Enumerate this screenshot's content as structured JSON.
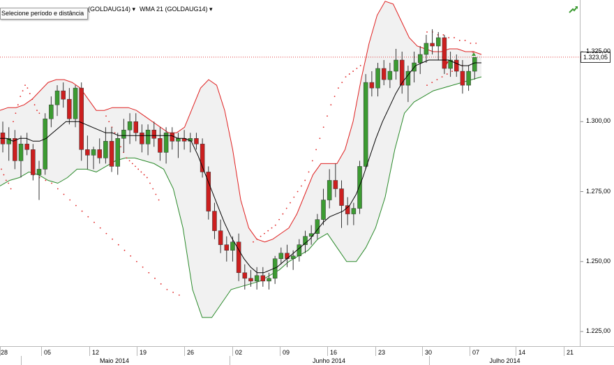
{
  "header": {
    "tooltip": "Selecione período e distância",
    "indicator_1": "(GOLDAUG14)",
    "indicator_2": "WMA 21 (GOLDAUG14)",
    "dropdown_glyph": "▾"
  },
  "price_label": "1.323,05",
  "icons": {
    "trend_icon": "trend-arrow-icon",
    "up_marker": "up-triangle-icon",
    "down_marker": "down-triangle-icon",
    "x_marker": "x-marker-icon"
  },
  "colors": {
    "bull": "#3c9b32",
    "bear": "#cc1f1f",
    "upper_band": "#e02020",
    "lower_band": "#2a8a2a",
    "wma": "#000000",
    "band_fill": "#f1f1f1",
    "sar": "#e02020",
    "price_line": "#e04040"
  },
  "x_axis_dates": [
    "28",
    "05",
    "12",
    "19",
    "26",
    "02",
    "09",
    "16",
    "23",
    "30",
    "07",
    "14",
    "21"
  ],
  "months": [
    "Maio 2014",
    "Junho 2014",
    "Julho 2014"
  ],
  "chart_data": {
    "type": "candlestick",
    "instrument": "GOLDAUG14",
    "y_ticks": [
      "1.225,00",
      "1.250,00",
      "1.275,00",
      "1.300,00",
      "1.325,00"
    ],
    "ylim": [
      1220,
      1345
    ],
    "last_price": 1323.05,
    "x_ticks": [
      "28",
      "05",
      "12",
      "19",
      "26",
      "02",
      "09",
      "16",
      "23",
      "30",
      "07",
      "14",
      "21"
    ],
    "months": [
      "Maio 2014",
      "Junho 2014",
      "Julho 2014"
    ],
    "candles_ohlc": [
      [
        1296,
        1300,
        1289,
        1292
      ],
      [
        1292,
        1298,
        1286,
        1294
      ],
      [
        1294,
        1297,
        1283,
        1286
      ],
      [
        1286,
        1295,
        1280,
        1292
      ],
      [
        1292,
        1296,
        1288,
        1290
      ],
      [
        1290,
        1292,
        1279,
        1281
      ],
      [
        1281,
        1286,
        1272,
        1283
      ],
      [
        1283,
        1303,
        1281,
        1301
      ],
      [
        1301,
        1309,
        1298,
        1306
      ],
      [
        1306,
        1313,
        1302,
        1311
      ],
      [
        1311,
        1314,
        1305,
        1308
      ],
      [
        1308,
        1312,
        1299,
        1301
      ],
      [
        1301,
        1313,
        1298,
        1312
      ],
      [
        1312,
        1314,
        1286,
        1290
      ],
      [
        1290,
        1295,
        1283,
        1288
      ],
      [
        1288,
        1291,
        1283,
        1290
      ],
      [
        1290,
        1294,
        1285,
        1287
      ],
      [
        1287,
        1298,
        1285,
        1293
      ],
      [
        1293,
        1298,
        1282,
        1284
      ],
      [
        1284,
        1296,
        1281,
        1294
      ],
      [
        1294,
        1301,
        1289,
        1297
      ],
      [
        1297,
        1303,
        1292,
        1300
      ],
      [
        1300,
        1303,
        1293,
        1296
      ],
      [
        1296,
        1299,
        1289,
        1292
      ],
      [
        1292,
        1299,
        1288,
        1297
      ],
      [
        1297,
        1300,
        1291,
        1294
      ],
      [
        1294,
        1298,
        1286,
        1289
      ],
      [
        1289,
        1298,
        1285,
        1296
      ],
      [
        1296,
        1298,
        1290,
        1293
      ],
      [
        1293,
        1296,
        1287,
        1294
      ],
      [
        1294,
        1297,
        1290,
        1293
      ],
      [
        1293,
        1296,
        1289,
        1294
      ],
      [
        1294,
        1296,
        1290,
        1292
      ],
      [
        1292,
        1294,
        1280,
        1282
      ],
      [
        1282,
        1284,
        1265,
        1268
      ],
      [
        1268,
        1271,
        1258,
        1261
      ],
      [
        1261,
        1265,
        1253,
        1256
      ],
      [
        1256,
        1259,
        1250,
        1254
      ],
      [
        1254,
        1259,
        1250,
        1257
      ],
      [
        1257,
        1260,
        1243,
        1246
      ],
      [
        1246,
        1249,
        1240,
        1244
      ],
      [
        1244,
        1247,
        1241,
        1243
      ],
      [
        1243,
        1248,
        1240,
        1245
      ],
      [
        1245,
        1248,
        1241,
        1243
      ],
      [
        1243,
        1246,
        1240,
        1244
      ],
      [
        1244,
        1252,
        1242,
        1251
      ],
      [
        1251,
        1255,
        1249,
        1253
      ],
      [
        1253,
        1256,
        1248,
        1251
      ],
      [
        1251,
        1254,
        1247,
        1252
      ],
      [
        1252,
        1258,
        1250,
        1256
      ],
      [
        1256,
        1261,
        1253,
        1259
      ],
      [
        1259,
        1263,
        1256,
        1260
      ],
      [
        1260,
        1267,
        1258,
        1265
      ],
      [
        1265,
        1276,
        1263,
        1272
      ],
      [
        1272,
        1283,
        1269,
        1279
      ],
      [
        1279,
        1285,
        1273,
        1276
      ],
      [
        1276,
        1279,
        1262,
        1270
      ],
      [
        1270,
        1273,
        1263,
        1267
      ],
      [
        1267,
        1271,
        1263,
        1269
      ],
      [
        1269,
        1286,
        1267,
        1284
      ],
      [
        1284,
        1317,
        1283,
        1314
      ],
      [
        1314,
        1318,
        1309,
        1312
      ],
      [
        1312,
        1321,
        1309,
        1319
      ],
      [
        1319,
        1322,
        1313,
        1315
      ],
      [
        1315,
        1321,
        1312,
        1318
      ],
      [
        1318,
        1326,
        1315,
        1322
      ],
      [
        1322,
        1325,
        1310,
        1313
      ],
      [
        1313,
        1320,
        1307,
        1318
      ],
      [
        1318,
        1325,
        1314,
        1321
      ],
      [
        1321,
        1327,
        1317,
        1324
      ],
      [
        1324,
        1331,
        1321,
        1328
      ],
      [
        1328,
        1333,
        1324,
        1327
      ],
      [
        1327,
        1332,
        1322,
        1330
      ],
      [
        1330,
        1331,
        1317,
        1319
      ],
      [
        1319,
        1325,
        1316,
        1322
      ],
      [
        1322,
        1324,
        1316,
        1318
      ],
      [
        1318,
        1322,
        1310,
        1313
      ],
      [
        1313,
        1320,
        1311,
        1318
      ],
      [
        1318,
        1323,
        1315,
        1323
      ]
    ],
    "wma_21": [
      1294,
      1294,
      1293,
      1294,
      1294,
      1293,
      1293,
      1294,
      1296,
      1298,
      1300,
      1300,
      1300,
      1299,
      1298,
      1297,
      1296,
      1296,
      1295,
      1295,
      1295,
      1295,
      1295,
      1295,
      1295,
      1295,
      1295,
      1294,
      1294,
      1293,
      1288,
      1282,
      1276,
      1270,
      1264,
      1259,
      1255,
      1251,
      1248,
      1246,
      1246,
      1247,
      1248,
      1250,
      1252,
      1254,
      1256,
      1258,
      1261,
      1264,
      1266,
      1267,
      1268,
      1270,
      1274,
      1280,
      1287,
      1294,
      1300,
      1305,
      1310,
      1314,
      1317,
      1320,
      1321,
      1322,
      1322,
      1322,
      1322,
      1321,
      1320,
      1320,
      1321,
      1321
    ],
    "upper_band": [
      1304,
      1305,
      1305,
      1306,
      1308,
      1311,
      1314,
      1315,
      1315,
      1314,
      1312,
      1308,
      1304,
      1304,
      1305,
      1305,
      1305,
      1304,
      1302,
      1300,
      1298,
      1296,
      1296,
      1298,
      1305,
      1312,
      1315,
      1313,
      1304,
      1290,
      1272,
      1262,
      1258,
      1257,
      1258,
      1260,
      1262,
      1267,
      1274,
      1281,
      1285,
      1285,
      1285,
      1290,
      1300,
      1315,
      1328,
      1338,
      1343,
      1342,
      1336,
      1330,
      1327,
      1326,
      1325,
      1325,
      1326,
      1326,
      1325,
      1325,
      1324
    ],
    "lower_band": [
      1277,
      1279,
      1280,
      1282,
      1281,
      1279,
      1278,
      1280,
      1283,
      1283,
      1282,
      1284,
      1286,
      1287,
      1287,
      1286,
      1285,
      1283,
      1276,
      1262,
      1240,
      1230,
      1230,
      1235,
      1240,
      1241,
      1242,
      1243,
      1245,
      1247,
      1250,
      1252,
      1254,
      1258,
      1260,
      1255,
      1250,
      1250,
      1255,
      1262,
      1273,
      1290,
      1303,
      1307,
      1309,
      1311,
      1312,
      1313,
      1314,
      1315,
      1316
    ],
    "parabolic_sar": [
      [
        1283,
        1281,
        1279,
        1278,
        1276,
        1300,
        1303,
        1306,
        1309,
        1311,
        1313,
        1312,
        1310,
        1308,
        1306,
        1304,
        1303
      ],
      [
        1302,
        1300,
        1298,
        1296,
        1293,
        1291,
        1289,
        1287,
        1286,
        1285,
        1284,
        1283,
        1282,
        1281,
        1280,
        1278,
        1276,
        1274,
        1272
      ],
      [
        1281,
        1280,
        1279,
        1278,
        1276,
        1274,
        1272,
        1270,
        1268,
        1266,
        1264,
        1262,
        1260,
        1258,
        1256,
        1254,
        1252,
        1250,
        1248,
        1246,
        1244,
        1242,
        1240,
        1239,
        1238
      ],
      [
        1257,
        1258,
        1259,
        1260,
        1261,
        1262,
        1263,
        1265,
        1267,
        1269,
        1271,
        1273,
        1275,
        1277,
        1279,
        1282,
        1286,
        1290,
        1294,
        1298,
        1302,
        1306,
        1309,
        1312,
        1314,
        1316,
        1317,
        1318,
        1319,
        1320
      ],
      [
        1332,
        1332,
        1331,
        1331,
        1330,
        1330,
        1329,
        1329,
        1328,
        1328
      ],
      [
        1313,
        1314,
        1315,
        1316,
        1317,
        1318,
        1319,
        1320
      ]
    ]
  }
}
